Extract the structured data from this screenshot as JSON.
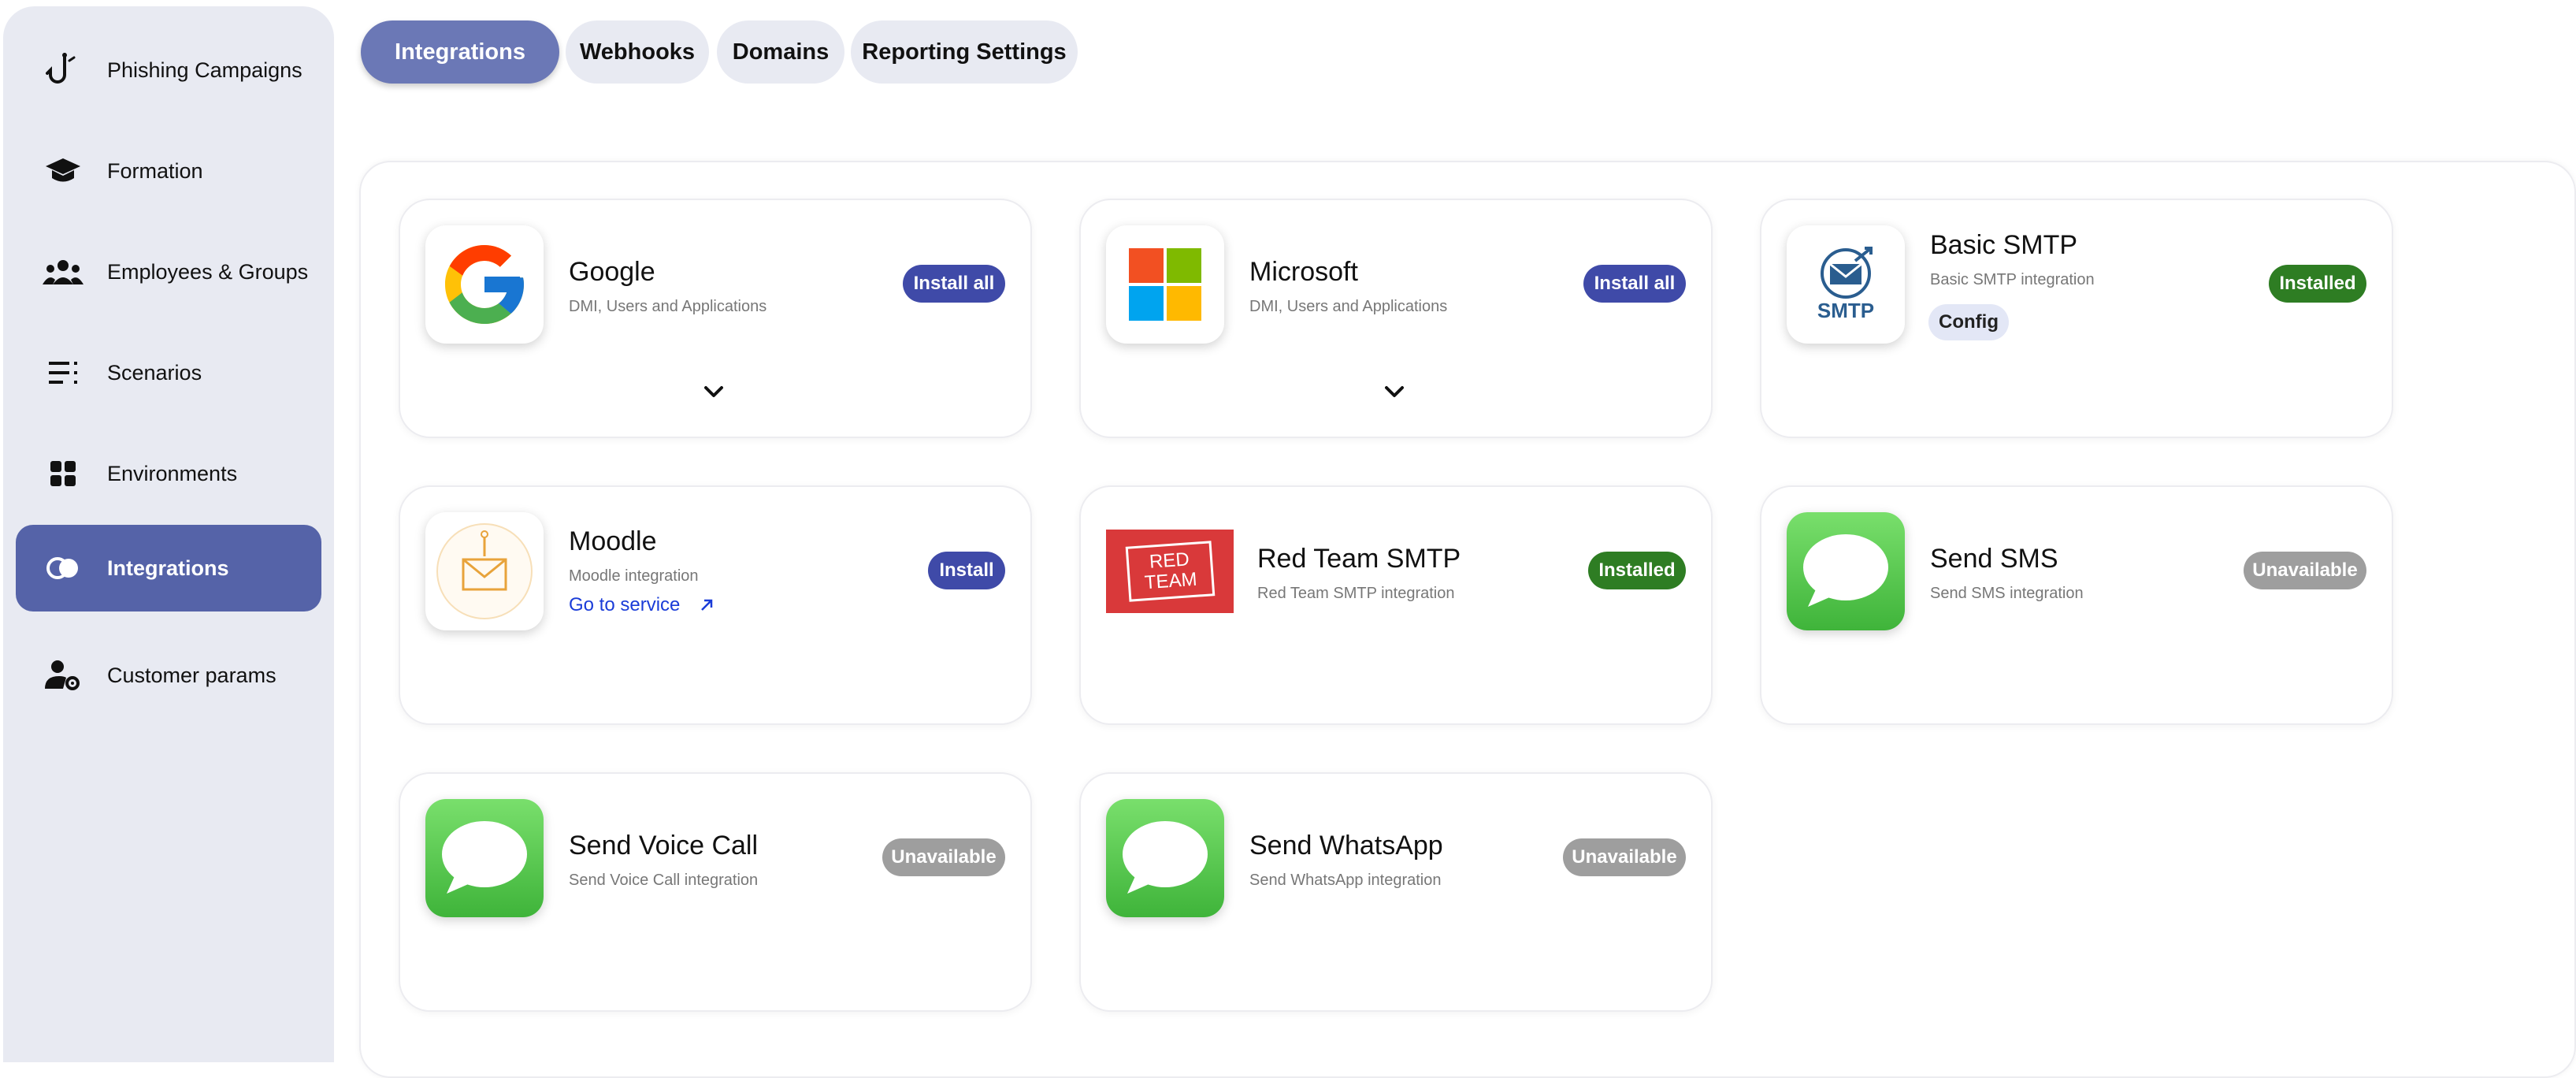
{
  "sidebar": {
    "items": [
      {
        "label": "Phishing Campaigns",
        "icon": "fishhook-icon"
      },
      {
        "label": "Formation",
        "icon": "graduation-cap-icon"
      },
      {
        "label": "Employees & Groups",
        "icon": "people-group-icon"
      },
      {
        "label": "Scenarios",
        "icon": "list-icon"
      },
      {
        "label": "Environments",
        "icon": "grid-icon"
      },
      {
        "label": "Integrations",
        "icon": "integrations-icon",
        "active": true
      },
      {
        "label": "Customer params",
        "icon": "user-settings-icon"
      }
    ]
  },
  "tabs": [
    {
      "label": "Integrations",
      "active": true
    },
    {
      "label": "Webhooks"
    },
    {
      "label": "Domains"
    },
    {
      "label": "Reporting Settings"
    }
  ],
  "cards": {
    "google": {
      "title": "Google",
      "subtitle": "DMI, Users and Applications",
      "action": "Install all"
    },
    "microsoft": {
      "title": "Microsoft",
      "subtitle": "DMI, Users and Applications",
      "action": "Install all"
    },
    "basic_smtp": {
      "title": "Basic SMTP",
      "subtitle": "Basic SMTP integration",
      "status": "Installed",
      "config": "Config",
      "logo_text": "SMTP"
    },
    "moodle": {
      "title": "Moodle",
      "subtitle": "Moodle integration",
      "action": "Install",
      "link": "Go to service"
    },
    "red_team": {
      "title": "Red Team SMTP",
      "subtitle": "Red Team SMTP integration",
      "status": "Installed",
      "logo_line1": "RED",
      "logo_line2": "TEAM"
    },
    "send_sms": {
      "title": "Send SMS",
      "subtitle": "Send SMS integration",
      "status": "Unavailable"
    },
    "voice": {
      "title": "Send Voice Call",
      "subtitle": "Send Voice Call integration",
      "status": "Unavailable"
    },
    "whatsapp": {
      "title": "Send WhatsApp",
      "subtitle": "Send WhatsApp integration",
      "status": "Unavailable"
    }
  },
  "colors": {
    "accent": "#5563a8",
    "install_blue": "#3f4aa8",
    "installed_green": "#2e7d23",
    "unavailable_grey": "#9e9e9e"
  }
}
